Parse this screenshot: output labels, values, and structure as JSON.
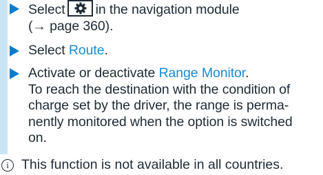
{
  "steps": [
    {
      "lines": [
        {
          "before": "Select",
          "icon": "gear-icon",
          "after": "in the navigation module"
        },
        {
          "text": "(→ page 360)."
        }
      ]
    },
    {
      "prefix": "Select ",
      "link": "Route",
      "suffix": "."
    },
    {
      "prefix": "Activate or deactivate ",
      "link": "Range Monitor",
      "suffix": ".",
      "description": [
        "To reach the destination with the condition of",
        "charge set by the driver, the range is perma-",
        "nently monitored when the option is switched",
        "on."
      ]
    }
  ],
  "note": {
    "icon": "info-icon",
    "icon_glyph": "i",
    "text": "This function is not available in all countries."
  },
  "colors": {
    "marker": "#0a7ccb",
    "bar": "#c9e6f6",
    "link": "#1a8ad0",
    "text": "#1f2a33"
  }
}
